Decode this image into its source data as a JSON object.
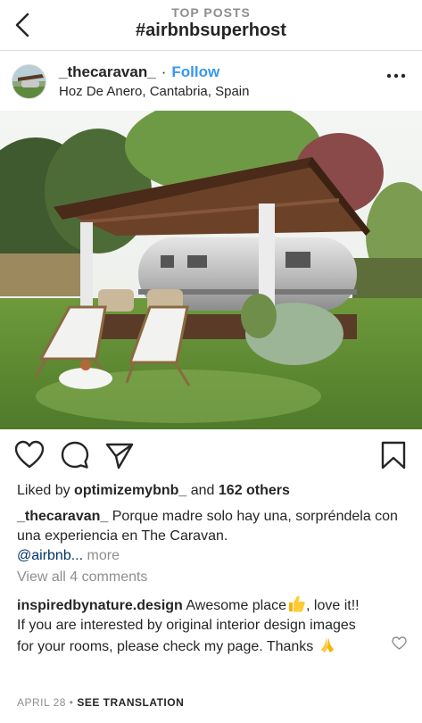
{
  "header": {
    "subtitle": "TOP POSTS",
    "title": "#airbnbsuperhost"
  },
  "post": {
    "username": "_thecaravan_",
    "separator": "·",
    "follow_label": "Follow",
    "location": "Hoz De Anero, Cantabria, Spain"
  },
  "likes": {
    "prefix": "Liked by",
    "user": "optimizemybnb_",
    "conjunction": "and",
    "others": "162 others"
  },
  "caption": {
    "username": "_thecaravan_",
    "text": "Porque madre solo hay una, sorpréndela con una experiencia en The Caravan.",
    "mention": "@airbnb...",
    "more_label": "more"
  },
  "view_all_comments": "View all 4 comments",
  "comment": {
    "username": "inspiredbynature.design",
    "text_1": "Awesome place",
    "text_2": ", love it!!",
    "text_3": "If you are interested by original interior design images for your rooms, please check my page. Thanks"
  },
  "footer": {
    "date": "APRIL 28",
    "separator": "•",
    "translation_label": "SEE TRANSLATION"
  },
  "colors": {
    "link_blue": "#3897f0",
    "mention_blue": "#003569",
    "muted_gray": "#8e8e8e",
    "text": "#262626"
  },
  "icons": [
    "back-chevron-icon",
    "more-options-icon",
    "heart-icon",
    "comment-icon",
    "share-icon",
    "bookmark-icon",
    "comment-heart-icon",
    "thumbs-up-emoji",
    "praying-hands-emoji"
  ]
}
